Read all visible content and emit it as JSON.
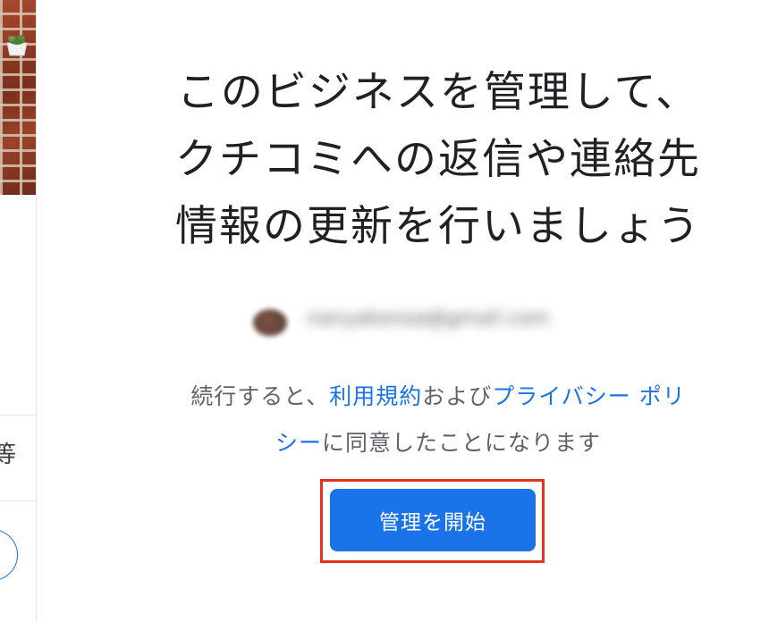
{
  "heading": {
    "line1": "このビジネスを管理して、",
    "line2": "クチコミへの返信や連絡先",
    "line3": "情報の更新を行いましょう"
  },
  "account": {
    "email": "nanyakonoa@gmail.com"
  },
  "legal": {
    "prefix": "続行すると、",
    "terms_link": "利用規約",
    "and": "および",
    "privacy_link_part1": "プライバシー ポリ",
    "privacy_link_part2": "シー",
    "suffix": "に同意したことになります"
  },
  "cta": {
    "label": "管理を開始"
  },
  "left_panel": {
    "partial_text": "等"
  },
  "colors": {
    "primary": "#1a73e8",
    "highlight": "#e8321e",
    "text": "#202124",
    "secondary_text": "#5f6368"
  }
}
